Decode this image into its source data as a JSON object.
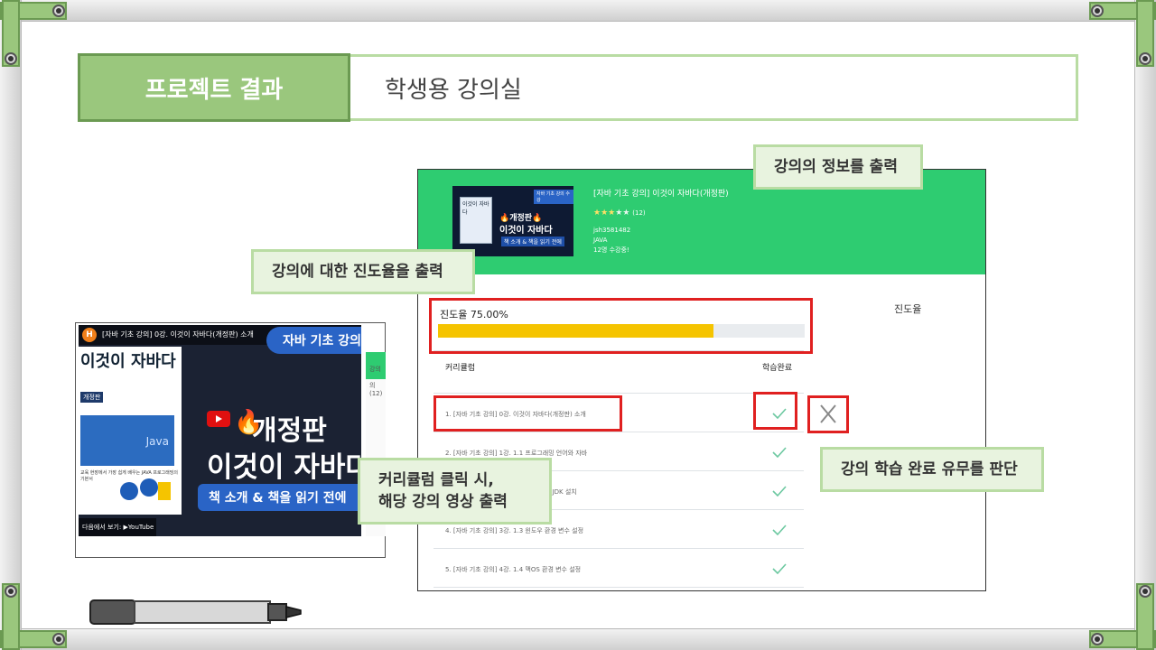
{
  "header": {
    "section_tab": "프로젝트 결과",
    "title": "학생용 강의실"
  },
  "course": {
    "thumbnail": {
      "badge": "자바 기초 강의 수강",
      "book_title": "이것이 자바다",
      "line1": "🔥개정판🔥",
      "line2": "이것이 자바다",
      "line3": "책 소개 & 책을 읽기 전에"
    },
    "title": "[자바 기초 강의] 이것이 자바다(개정판)",
    "rating_stars": 3,
    "rating_max": 5,
    "rating_count": "(12)",
    "instructor": "jsh3581482",
    "category": "JAVA",
    "students": "12명 수강중!"
  },
  "progress": {
    "label": "진도율 75.00%",
    "value_percent": 75,
    "side_label": "진도율"
  },
  "curriculum": {
    "header_curriculum": "커리큘럼",
    "header_done": "학습완료",
    "rows": [
      {
        "text": "1. [자바 기초 강의] 0강. 이것이 자바다(개정판) 소개",
        "done": true
      },
      {
        "text": "2. [자바 기초 강의] 1강. 1.1 프로그래밍 언어와 자바",
        "done": true
      },
      {
        "text": "3. [자바 기초 강의] 2강. 1.2 자바 개발 JDK 설치",
        "done": true
      },
      {
        "text": "4. [자바 기초 강의] 3강. 1.3 윈도우 환경 변수 설정",
        "done": true
      },
      {
        "text": "5. [자바 기초 강의] 4강. 1.4 맥OS 환경 변수 설정",
        "done": true
      }
    ]
  },
  "callouts": {
    "course_info": "강의의 정보를 출력",
    "progress": "강의에 대한 진도율을 출력",
    "curriculum_line1": "커리큘럼 클릭 시,",
    "curriculum_line2": "해당 강의 영상 출력",
    "completion": "강의 학습 완료 유무를 판단"
  },
  "video": {
    "channel_logo": "H",
    "title": "[자바 기초 강의] 0강. 이것이 자바다(개정판) 소개",
    "pill": "자바 기초 강의",
    "book_title": "이것이 자바다",
    "book_edition": "개정판",
    "book_caption": "교육 현장에서 가장 쉽게 배우는 JAVA 프로그래밍의 기본서",
    "headline1": "개정판",
    "headline2": "이것이 자바다",
    "subtitle": "책 소개 & 책을 읽기 전에",
    "footer": "다음에서 보기: ▶YouTube",
    "side_text1": "강의",
    "side_text2": "의 (12)"
  },
  "colors": {
    "accent_green": "#2ecc71",
    "header_green": "#9ac77d",
    "progress_yellow": "#f5c400",
    "highlight_red": "#e02020"
  }
}
